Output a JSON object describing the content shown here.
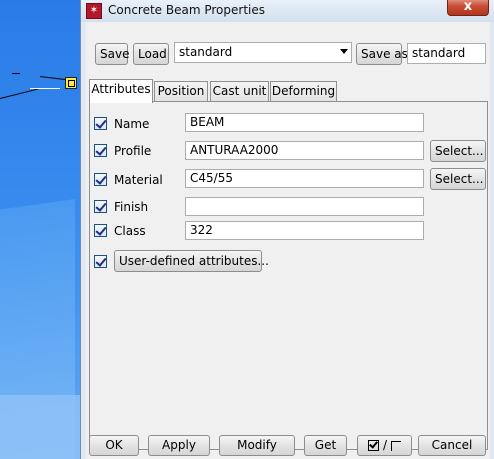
{
  "window": {
    "title": "Concrete Beam Properties",
    "close_label": "x"
  },
  "toolbar": {
    "save_label": "Save",
    "load_label": "Load",
    "preset_value": "standard",
    "save_as_label": "Save as",
    "save_as_name": "standard"
  },
  "tabs": [
    {
      "label": "Attributes",
      "active": true
    },
    {
      "label": "Position",
      "active": false
    },
    {
      "label": "Cast unit",
      "active": false
    },
    {
      "label": "Deforming",
      "active": false
    }
  ],
  "attributes": {
    "name": {
      "label": "Name",
      "value": "BEAM",
      "checked": true
    },
    "profile": {
      "label": "Profile",
      "value": "ANTURAA2000",
      "checked": true,
      "select_label": "Select..."
    },
    "material": {
      "label": "Material",
      "value": "C45/55",
      "checked": true,
      "select_label": "Select..."
    },
    "finish": {
      "label": "Finish",
      "value": "",
      "checked": true
    },
    "class": {
      "label": "Class",
      "value": "322",
      "checked": true
    },
    "user_defined": {
      "label": "User-defined attributes...",
      "checked": true
    }
  },
  "footer": {
    "ok_label": "OK",
    "apply_label": "Apply",
    "modify_label": "Modify",
    "get_label": "Get",
    "toggle_separator": "/",
    "cancel_label": "Cancel"
  },
  "colors": {
    "viewport_blue": "#2f7fe6",
    "close_red": "#c9503a",
    "app_icon_red": "#b3182a"
  }
}
